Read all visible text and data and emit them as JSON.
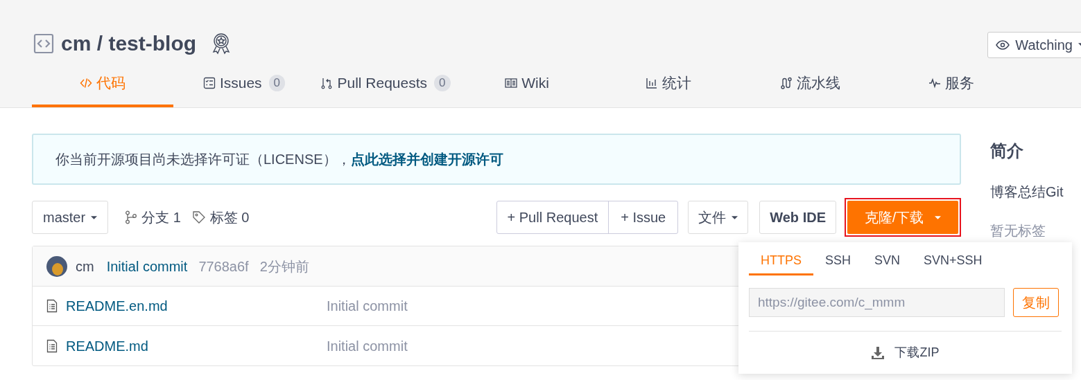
{
  "repo": {
    "owner": "cm",
    "name": "test-blog",
    "separator": "/"
  },
  "watch_button": {
    "label": "Watching"
  },
  "tabs": [
    {
      "kind": "code",
      "label": "代码",
      "selected": true
    },
    {
      "kind": "issues",
      "label": "Issues",
      "count": "0",
      "selected": false
    },
    {
      "kind": "pulls",
      "label": "Pull Requests",
      "count": "0",
      "selected": false
    },
    {
      "kind": "wiki",
      "label": "Wiki",
      "selected": false
    },
    {
      "kind": "stats",
      "label": "统计",
      "selected": false
    },
    {
      "kind": "pipeline",
      "label": "流水线",
      "selected": false
    },
    {
      "kind": "service",
      "label": "服务",
      "selected": false
    }
  ],
  "license_notice": {
    "text": "你当前开源项目尚未选择许可证（LICENSE），",
    "link": "点此选择并创建开源许可"
  },
  "toolbar": {
    "branch": "master",
    "branches": "分支 1",
    "tags": "标签 0",
    "pull_request_button": "+ Pull Request",
    "issue_button": "+ Issue",
    "file_button": "文件",
    "web_ide_button": "Web IDE",
    "clone_button": {
      "label": "克隆/下载",
      "highlighted": true
    }
  },
  "commit": {
    "author": "cm",
    "message": "Initial commit",
    "hash": "7768a6f",
    "time": "2分钟前"
  },
  "files": [
    {
      "name": "README.en.md",
      "commit": "Initial commit"
    },
    {
      "name": "README.md",
      "commit": "Initial commit"
    }
  ],
  "sidebar": {
    "heading": "简介",
    "description": "博客总结Git",
    "tags": "暂无标签"
  },
  "clone_popup": {
    "tabs": [
      {
        "label": "HTTPS",
        "selected": true
      },
      {
        "label": "SSH",
        "selected": false
      },
      {
        "label": "SVN",
        "selected": false
      },
      {
        "label": "SVN+SSH",
        "selected": false
      }
    ],
    "url": "https://gitee.com/c_mmm",
    "copy_button": "复制",
    "download": "下载ZIP"
  }
}
